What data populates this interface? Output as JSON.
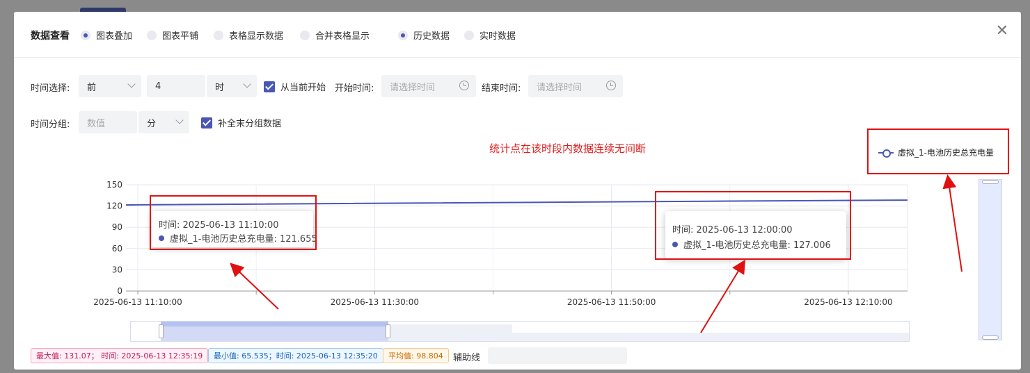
{
  "modal": {
    "title": "数据查看",
    "close_icon": "close-icon",
    "view_modes": [
      {
        "label": "图表叠加",
        "selected": true
      },
      {
        "label": "图表平铺",
        "selected": false
      },
      {
        "label": "表格显示数据",
        "selected": false
      },
      {
        "label": "合并表格显示",
        "selected": false
      }
    ],
    "data_modes": [
      {
        "label": "历史数据",
        "selected": true
      },
      {
        "label": "实时数据",
        "selected": false
      }
    ]
  },
  "filters": {
    "time_select_label": "时间选择:",
    "direction": "前",
    "amount": "4",
    "unit": "时",
    "from_now_label": "从当前开始",
    "from_now_checked": true,
    "start_label": "开始时间:",
    "start_placeholder": "请选择时间",
    "end_label": "结束时间:",
    "end_placeholder": "请选择时间",
    "group_label": "时间分组:",
    "group_value_placeholder": "数值",
    "group_unit": "分",
    "fill_label": "补全末分组数据",
    "fill_checked": true
  },
  "annotation": "统计点在该时段内数据连续无间断",
  "chart_data": {
    "type": "line",
    "title": "",
    "xlabel": "",
    "ylabel": "",
    "ylim": [
      0,
      150
    ],
    "yticks": [
      0,
      30,
      60,
      90,
      120,
      150
    ],
    "xtick_labels": [
      "2025-06-13 11:10:00",
      "2025-06-13 11:30:00",
      "2025-06-13 11:50:00",
      "2025-06-13 12:10:00"
    ],
    "grid": true,
    "legend_position": "top-right",
    "series": [
      {
        "name": "虚拟_1-电池历史总充电量",
        "color": "#4a56b5",
        "points": [
          {
            "t": "2025-06-13 11:10:00",
            "v": 121.655
          },
          {
            "t": "2025-06-13 12:00:00",
            "v": 127.006
          },
          {
            "t": "2025-06-13 12:15:00",
            "v": 128.3
          }
        ]
      }
    ],
    "x_start": "2025-06-13 11:09:00",
    "x_end": "2025-06-13 12:15:00"
  },
  "tooltips": [
    {
      "time_label": "时间: 2025-06-13 11:10:00",
      "series_label": "虚拟_1-电池历史总充电量: 121.655"
    },
    {
      "time_label": "时间: 2025-06-13 12:00:00",
      "series_label": "虚拟_1-电池历史总充电量: 127.006"
    }
  ],
  "stats": {
    "max": "最大值: 131.07；   时间: 2025-06-13 12:35:19",
    "min": "最小值: 65.535；时间: 2025-06-13 12:35:20",
    "avg": "平均值: 98.804"
  },
  "aux_line_label": "辅助线"
}
